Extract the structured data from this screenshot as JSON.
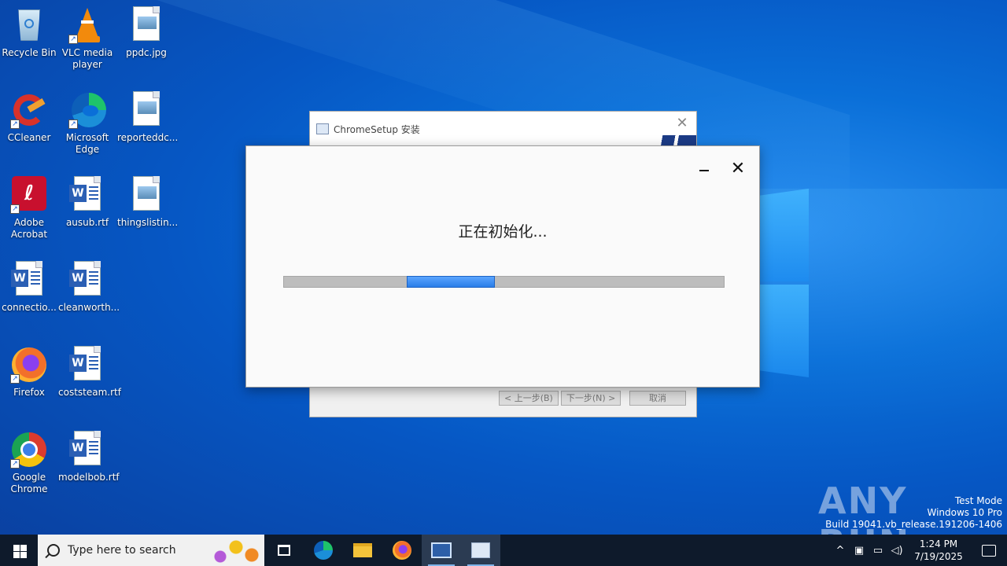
{
  "desktop": {
    "icons": [
      {
        "label": "Recycle Bin",
        "icon": "recycle-bin-icon"
      },
      {
        "label": "VLC media player",
        "icon": "vlc-icon"
      },
      {
        "label": "ppdc.jpg",
        "icon": "image-file-icon"
      },
      {
        "label": "CCleaner",
        "icon": "ccleaner-icon"
      },
      {
        "label": "Microsoft Edge",
        "icon": "edge-icon"
      },
      {
        "label": "reporteddc...",
        "icon": "image-file-icon"
      },
      {
        "label": "Adobe Acrobat",
        "icon": "acrobat-icon"
      },
      {
        "label": "ausub.rtf",
        "icon": "word-doc-icon"
      },
      {
        "label": "thingslistin...",
        "icon": "image-file-icon"
      },
      {
        "label": "connectio...",
        "icon": "word-doc-icon"
      },
      {
        "label": "cleanworth...",
        "icon": "word-doc-icon"
      },
      {
        "label": "Firefox",
        "icon": "firefox-icon"
      },
      {
        "label": "coststeam.rtf",
        "icon": "word-doc-icon"
      },
      {
        "label": "Google Chrome",
        "icon": "chrome-icon"
      },
      {
        "label": "modelbob.rtf",
        "icon": "word-doc-icon"
      }
    ]
  },
  "setup_window": {
    "title": "ChromeSetup 安装",
    "back_label": "< 上一步(B)",
    "next_label": "下一步(N) >",
    "cancel_label": "取消"
  },
  "init_dialog": {
    "message": "正在初始化...",
    "progress_indeterminate": true
  },
  "watermark": {
    "line1": "Test Mode",
    "line2": "Windows 10 Pro",
    "line3": "Build 19041.vb_release.191206-1406",
    "brand": "ANY RUN"
  },
  "taskbar": {
    "search_placeholder": "Type here to search",
    "time": "1:24 PM",
    "date": "7/19/2025"
  },
  "colors": {
    "accent": "#2a7de8",
    "taskbar": "#0e1a2b"
  }
}
